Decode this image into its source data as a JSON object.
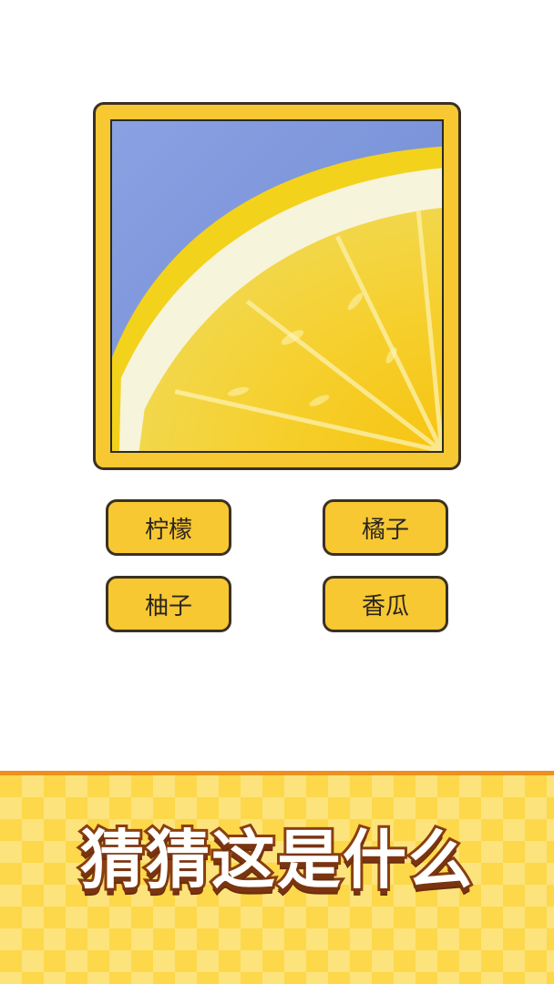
{
  "quiz": {
    "image_subject": "lemon-slice",
    "options": [
      "柠檬",
      "橘子",
      "柚子",
      "香瓜"
    ]
  },
  "banner": {
    "title": "猜猜这是什么"
  },
  "colors": {
    "frame_yellow": "#f8c832",
    "outline": "#3a3124",
    "banner_yellow": "#fcd84a",
    "banner_border": "#ee8f1e",
    "title_stroke": "#8a3f10"
  }
}
